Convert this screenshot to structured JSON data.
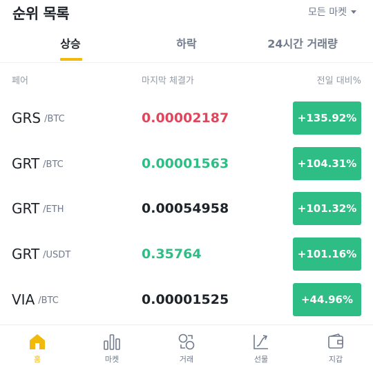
{
  "header": {
    "title": "순위 목록",
    "market_filter": "모든 마켓"
  },
  "tabs": [
    {
      "label": "상승",
      "active": true
    },
    {
      "label": "하락",
      "active": false
    },
    {
      "label": "24시간 거래량",
      "active": false
    }
  ],
  "columns": {
    "pair": "페어",
    "last_price": "마지막 체결가",
    "change": "전일 대비%"
  },
  "rows": [
    {
      "base": "GRS",
      "quote": "/BTC",
      "price": "0.00002187",
      "price_color": "#e0455c",
      "change": "+135.92%"
    },
    {
      "base": "GRT",
      "quote": "/BTC",
      "price": "0.00001563",
      "price_color": "#2ebd85",
      "change": "+104.31%"
    },
    {
      "base": "GRT",
      "quote": "/ETH",
      "price": "0.00054958",
      "price_color": "#1e2329",
      "change": "+101.32%"
    },
    {
      "base": "GRT",
      "quote": "/USDT",
      "price": "0.35764",
      "price_color": "#2ebd85",
      "change": "+101.16%"
    },
    {
      "base": "VIA",
      "quote": "/BTC",
      "price": "0.00001525",
      "price_color": "#1e2329",
      "change": "+44.96%"
    }
  ],
  "nav": [
    {
      "label": "홈",
      "icon": "home-icon",
      "active": true
    },
    {
      "label": "마켓",
      "icon": "bar-chart-icon",
      "active": false
    },
    {
      "label": "거래",
      "icon": "trade-icon",
      "active": false
    },
    {
      "label": "선물",
      "icon": "futures-icon",
      "active": false
    },
    {
      "label": "지갑",
      "icon": "wallet-icon",
      "active": false
    }
  ],
  "colors": {
    "accent": "#f0b90b",
    "up": "#2ebd85",
    "down": "#e0455c"
  }
}
